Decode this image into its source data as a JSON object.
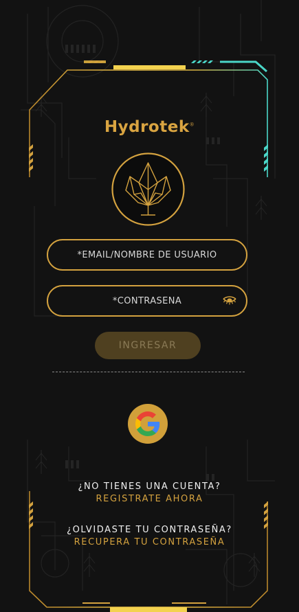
{
  "brand": {
    "name": "Hydrotek",
    "trademark": "®"
  },
  "form": {
    "email_placeholder": "*EMAIL/NOMBRE DE USUARIO",
    "password_placeholder": "*CONTRASEÑA",
    "login_label": "INGRESAR"
  },
  "signup": {
    "question": "¿NO TIENES UNA CUENTA?",
    "link": "REGISTRATE AHORA"
  },
  "recover": {
    "question": "¿OLVIDASTE TU CONTRASEÑA?",
    "link": "RECUPERA TU CONTRASEÑA"
  },
  "icons": {
    "emblem": "lotus-crown-emblem",
    "password_toggle": "eye-closed-icon",
    "social_login": "google-icon"
  },
  "colors": {
    "background": "#121212",
    "gold": "#d4a23f",
    "button_disabled": "#4f4020",
    "accent_cyan": "#4ad6c8"
  }
}
